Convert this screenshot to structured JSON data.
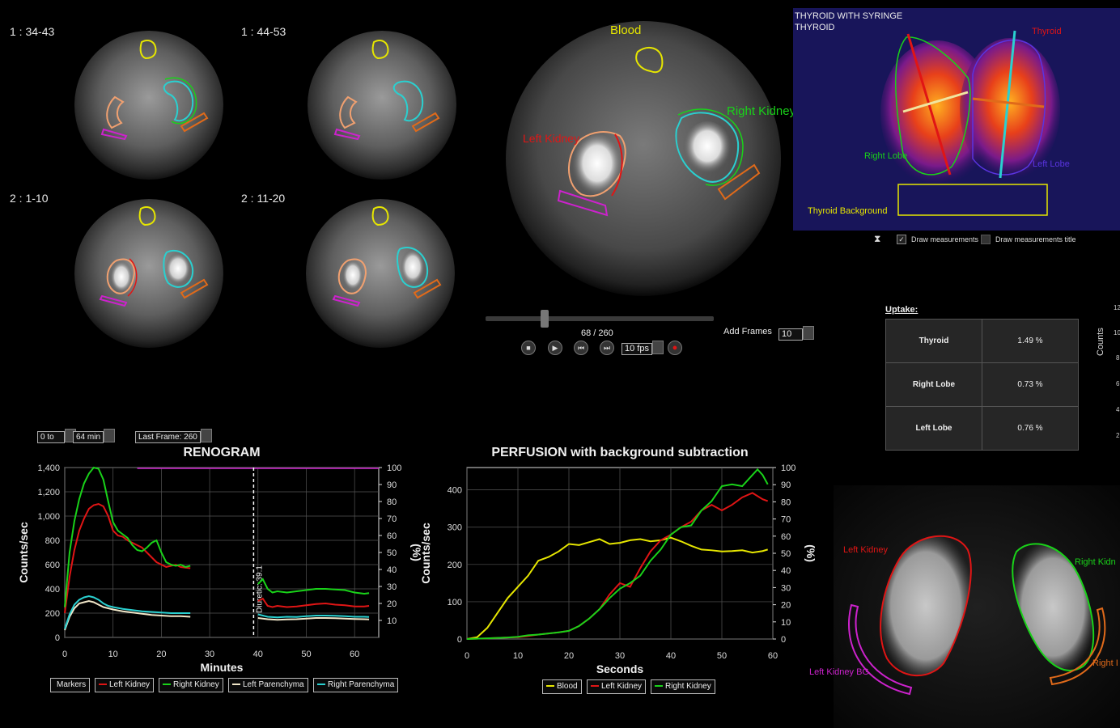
{
  "frames": {
    "f1_label": "1 : 34-43",
    "f2_label": "1 : 44-53",
    "f3_label": "2 : 1-10",
    "f4_label": "2 : 11-20"
  },
  "big_view": {
    "blood": "Blood",
    "right_kidney": "Right Kidney",
    "left_kidney": "Left Kidney"
  },
  "player": {
    "frame_counter": "68 / 260",
    "fps": "10 fps",
    "add_frames_label": "Add Frames",
    "add_frames_value": "10",
    "slider_fraction": 0.26
  },
  "thyroid": {
    "title_line1": "THYROID WITH SYRINGE",
    "title_line2": "THYROID",
    "thyroid": "Thyroid",
    "right_lobe": "Right Lobe",
    "left_lobe": "Left Lobe",
    "background": "Thyroid Background",
    "draw_measurements": "Draw measurements",
    "draw_measurements_title": "Draw measurements title",
    "draw_measurements_checked": true,
    "draw_measurements_title_checked": false
  },
  "uptake": {
    "heading": "Uptake:",
    "rows": [
      {
        "name": "Thyroid",
        "value": "1.49 %"
      },
      {
        "name": "Right Lobe",
        "value": "0.73 %"
      },
      {
        "name": "Left Lobe",
        "value": "0.76 %"
      }
    ]
  },
  "right_axis": {
    "label": "Counts",
    "ticks": [
      "12",
      "10",
      "8",
      "6",
      "4",
      "2"
    ]
  },
  "renogram_controls": {
    "from": "0 to",
    "to": "64 min",
    "last_frame": "Last Frame: 260"
  },
  "kidney_image": {
    "left_kidney": "Left Kidney",
    "right_kidney": "Right Kidn",
    "left_kidney_bg": "Left Kidney BG",
    "right_bg": "Right I"
  },
  "colors": {
    "green": "#19d219",
    "red": "#e01515",
    "yellow": "#e6e600",
    "cyan": "#2ad0d0",
    "cream": "#f0e6c8",
    "magenta": "#cc22cc",
    "orange": "#e06a1a"
  },
  "chart_data": [
    {
      "type": "line",
      "title": "RENOGRAM",
      "xlabel": "Minutes",
      "ylabel": "Counts/sec",
      "y2label": "(%)",
      "xlim": [
        0,
        65
      ],
      "ylim": [
        0,
        1400
      ],
      "y2lim": [
        0,
        100
      ],
      "x_ticks": [
        "0",
        "10",
        "20",
        "30",
        "40",
        "50",
        "60"
      ],
      "y_ticks": [
        "0",
        "200",
        "400",
        "600",
        "800",
        "1,000",
        "1,200",
        "1,400"
      ],
      "y2_ticks": [
        "10",
        "20",
        "30",
        "40",
        "50",
        "60",
        "70",
        "80",
        "90",
        "100"
      ],
      "grid": true,
      "annotation": "Diuretic: 39.1",
      "marker_x": 39.1,
      "series": [
        {
          "name": "Left Kidney",
          "color": "#e01515",
          "x": [
            0,
            1,
            2,
            3,
            4,
            5,
            6,
            7,
            8,
            9,
            10,
            11,
            12,
            13,
            14,
            15,
            16,
            17,
            18,
            19,
            20,
            21,
            22,
            23,
            24,
            25,
            26
          ],
          "y": [
            200,
            500,
            720,
            880,
            980,
            1060,
            1090,
            1100,
            1080,
            1000,
            880,
            840,
            830,
            800,
            780,
            760,
            740,
            700,
            660,
            620,
            600,
            580,
            590,
            600,
            580,
            575,
            570
          ]
        },
        {
          "name": "Right Kidney",
          "color": "#19d219",
          "x": [
            0,
            1,
            2,
            3,
            4,
            5,
            6,
            7,
            8,
            9,
            10,
            11,
            12,
            13,
            14,
            15,
            16,
            17,
            18,
            19,
            20,
            21,
            22,
            23,
            24,
            25,
            26
          ],
          "y": [
            250,
            700,
            960,
            1140,
            1270,
            1350,
            1400,
            1390,
            1300,
            1120,
            950,
            880,
            850,
            820,
            760,
            720,
            710,
            740,
            780,
            800,
            700,
            620,
            600,
            590,
            600,
            580,
            590
          ]
        },
        {
          "name": "Left Parenchyma",
          "color": "#f0e6c8",
          "x": [
            0,
            1,
            2,
            3,
            4,
            5,
            6,
            7,
            8,
            9,
            10,
            12,
            14,
            16,
            18,
            20,
            22,
            24,
            26
          ],
          "y": [
            60,
            170,
            240,
            280,
            290,
            300,
            290,
            270,
            250,
            240,
            230,
            215,
            205,
            195,
            185,
            180,
            175,
            175,
            170
          ]
        },
        {
          "name": "Right Parenchyma",
          "color": "#2ad0d0",
          "x": [
            0,
            1,
            2,
            3,
            4,
            5,
            6,
            7,
            8,
            9,
            10,
            12,
            14,
            16,
            18,
            20,
            22,
            24,
            26
          ],
          "y": [
            70,
            190,
            270,
            310,
            330,
            340,
            330,
            310,
            280,
            260,
            250,
            235,
            225,
            215,
            210,
            205,
            200,
            200,
            200
          ]
        },
        {
          "name": "Right Kidney",
          "color": "#19d219",
          "x": [
            40,
            41,
            42,
            43,
            44,
            46,
            48,
            50,
            52,
            54,
            56,
            58,
            60,
            62,
            63
          ],
          "y": [
            440,
            480,
            400,
            370,
            380,
            370,
            380,
            390,
            400,
            400,
            395,
            390,
            370,
            360,
            365
          ]
        },
        {
          "name": "Left Kidney",
          "color": "#e01515",
          "x": [
            40,
            41,
            42,
            43,
            44,
            46,
            48,
            50,
            52,
            54,
            56,
            58,
            60,
            62,
            63
          ],
          "y": [
            300,
            320,
            260,
            250,
            260,
            250,
            255,
            265,
            275,
            280,
            270,
            265,
            255,
            255,
            260
          ]
        },
        {
          "name": "Right Parenchyma",
          "color": "#2ad0d0",
          "x": [
            40,
            42,
            44,
            46,
            48,
            50,
            52,
            54,
            56,
            58,
            60,
            62,
            63
          ],
          "y": [
            190,
            170,
            165,
            170,
            168,
            175,
            180,
            180,
            178,
            175,
            170,
            170,
            168
          ]
        },
        {
          "name": "Left Parenchyma",
          "color": "#f0e6c8",
          "x": [
            40,
            42,
            44,
            46,
            48,
            50,
            52,
            54,
            56,
            58,
            60,
            62,
            63
          ],
          "y": [
            160,
            150,
            145,
            148,
            150,
            155,
            160,
            160,
            158,
            155,
            152,
            150,
            148
          ]
        }
      ],
      "legend": [
        "Markers",
        "Left Kidney",
        "Right Kidney",
        "Left Parenchyma",
        "Right Parenchyma"
      ]
    },
    {
      "type": "line",
      "title": "PERFUSION with background subtraction",
      "xlabel": "Seconds",
      "ylabel": "Counts/sec",
      "y2label": "(%)",
      "xlim": [
        0,
        60
      ],
      "ylim": [
        0,
        460
      ],
      "y2lim": [
        0,
        100
      ],
      "x_ticks": [
        "0",
        "10",
        "20",
        "30",
        "40",
        "50",
        "60"
      ],
      "y_ticks": [
        "0",
        "100",
        "200",
        "300",
        "400"
      ],
      "y2_ticks": [
        "0",
        "10",
        "20",
        "30",
        "40",
        "50",
        "60",
        "70",
        "80",
        "90",
        "100"
      ],
      "grid": true,
      "series": [
        {
          "name": "Blood",
          "color": "#e6e600",
          "x": [
            0,
            2,
            4,
            6,
            8,
            10,
            12,
            14,
            16,
            18,
            20,
            22,
            24,
            26,
            28,
            30,
            32,
            34,
            36,
            38,
            40,
            42,
            44,
            46,
            48,
            50,
            52,
            54,
            56,
            58,
            59
          ],
          "y": [
            0,
            5,
            30,
            70,
            110,
            140,
            170,
            210,
            220,
            235,
            255,
            252,
            260,
            268,
            255,
            258,
            265,
            268,
            262,
            265,
            272,
            262,
            250,
            240,
            238,
            235,
            236,
            238,
            232,
            236,
            240
          ]
        },
        {
          "name": "Left Kidney",
          "color": "#e01515",
          "x": [
            0,
            4,
            8,
            10,
            12,
            14,
            16,
            18,
            20,
            22,
            24,
            26,
            28,
            30,
            32,
            34,
            36,
            38,
            40,
            42,
            44,
            46,
            48,
            50,
            52,
            54,
            56,
            58,
            59
          ],
          "y": [
            0,
            2,
            4,
            5,
            8,
            12,
            15,
            18,
            22,
            35,
            55,
            80,
            120,
            150,
            140,
            190,
            235,
            265,
            280,
            300,
            315,
            345,
            360,
            345,
            360,
            380,
            392,
            375,
            370
          ]
        },
        {
          "name": "Right Kidney",
          "color": "#19d219",
          "x": [
            0,
            4,
            8,
            10,
            12,
            14,
            16,
            18,
            20,
            22,
            24,
            26,
            28,
            30,
            32,
            34,
            36,
            38,
            40,
            42,
            44,
            46,
            48,
            50,
            52,
            54,
            56,
            57,
            58,
            59
          ],
          "y": [
            0,
            2,
            4,
            6,
            10,
            12,
            15,
            18,
            22,
            35,
            55,
            80,
            110,
            135,
            150,
            170,
            210,
            240,
            280,
            300,
            305,
            345,
            370,
            410,
            415,
            410,
            440,
            455,
            440,
            415
          ]
        }
      ],
      "legend": [
        "Blood",
        "Left Kidney",
        "Right Kidney"
      ]
    }
  ]
}
